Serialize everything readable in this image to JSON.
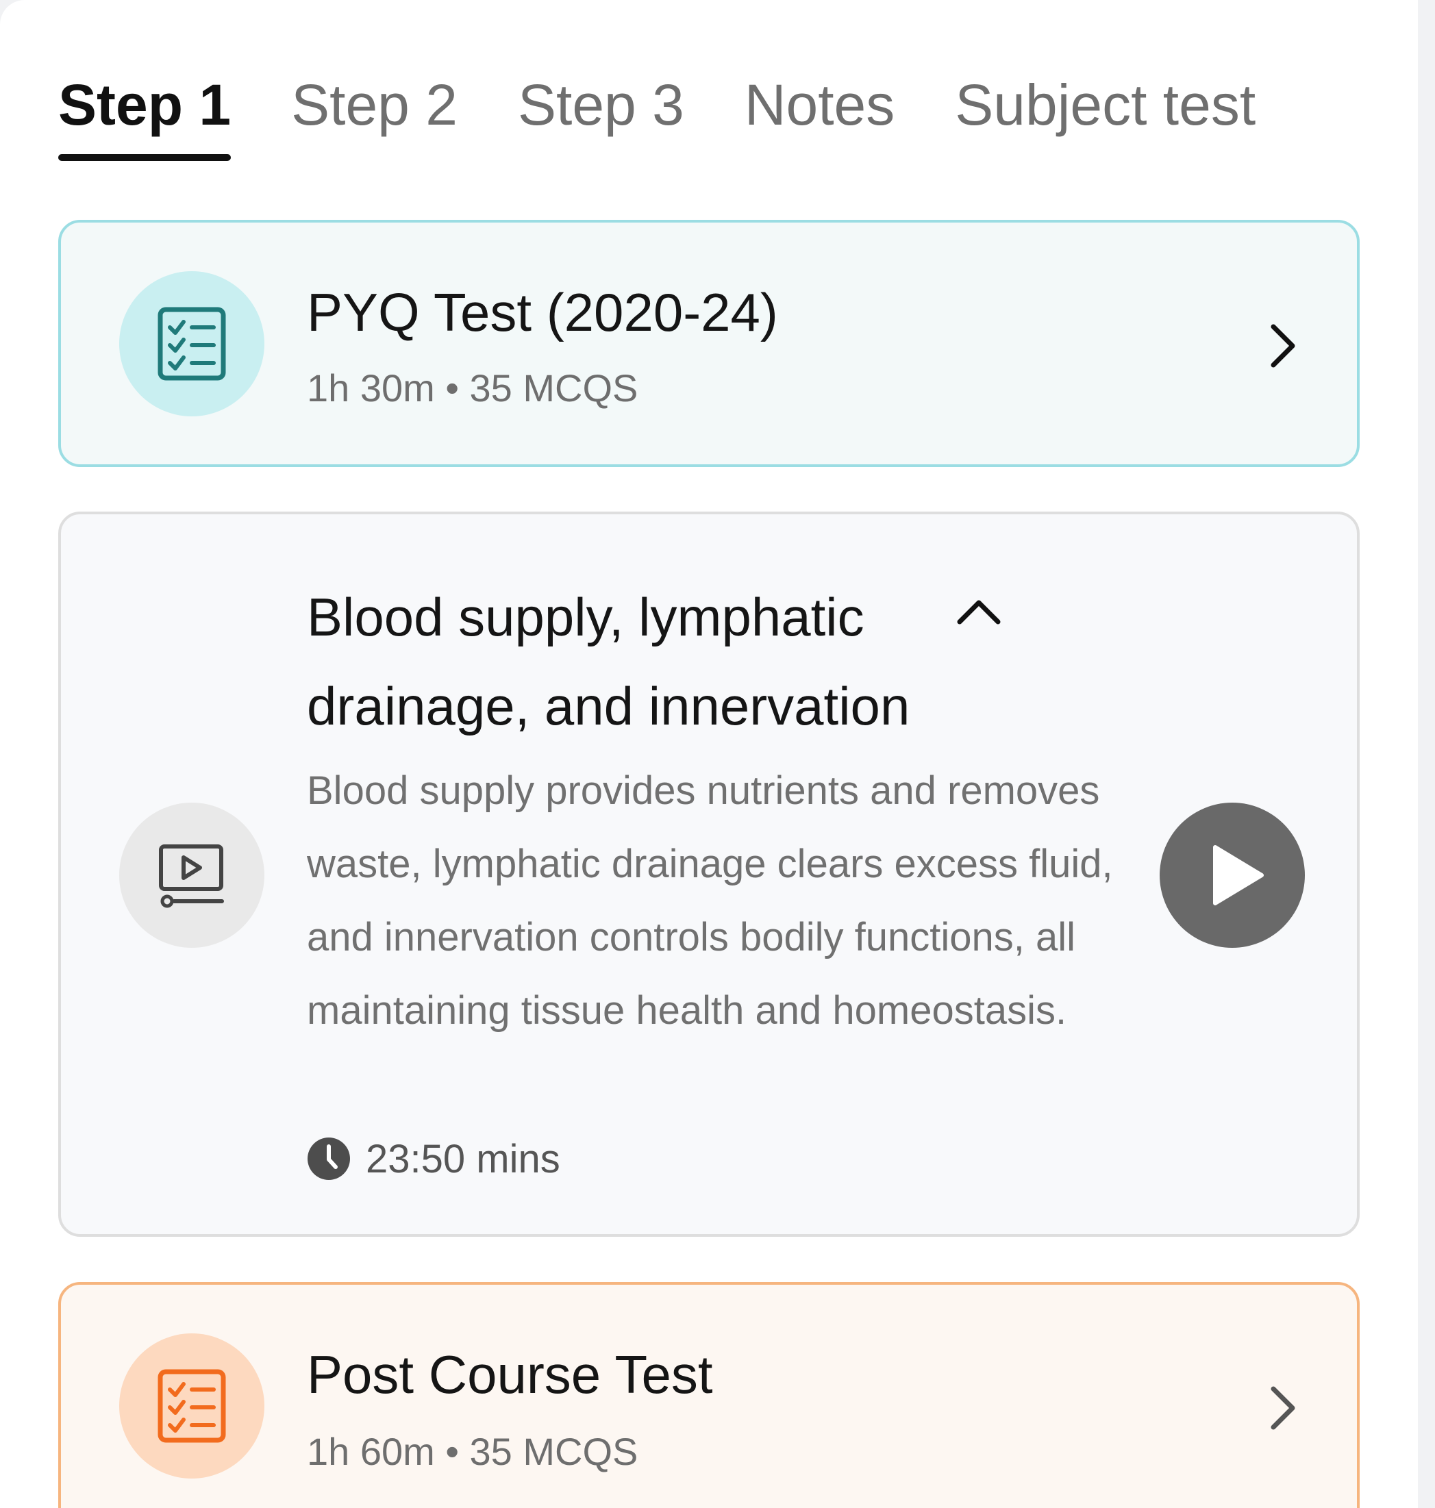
{
  "tabs": [
    {
      "label": "Step 1",
      "active": true
    },
    {
      "label": "Step 2",
      "active": false
    },
    {
      "label": "Step 3",
      "active": false
    },
    {
      "label": "Notes",
      "active": false
    },
    {
      "label": "Subject test",
      "active": false
    }
  ],
  "pyq_card": {
    "title": "PYQ Test (2020-24)",
    "meta": "1h 30m • 35 MCQS",
    "icon": "checklist-icon",
    "accent": "#1f7a7a"
  },
  "video_card": {
    "title": "Blood supply, lymphatic drainage, and innervation",
    "description": "Blood supply provides nutrients and removes waste, lymphatic drainage clears excess fluid, and innervation controls bodily functions, all maintaining tissue health and homeostasis.",
    "duration": "23:50 mins",
    "icon": "video-lesson-icon",
    "expanded": true
  },
  "post_card": {
    "title": "Post Course Test",
    "meta": "1h 60m • 35 MCQS",
    "icon": "checklist-icon",
    "accent": "#f26b1d"
  }
}
